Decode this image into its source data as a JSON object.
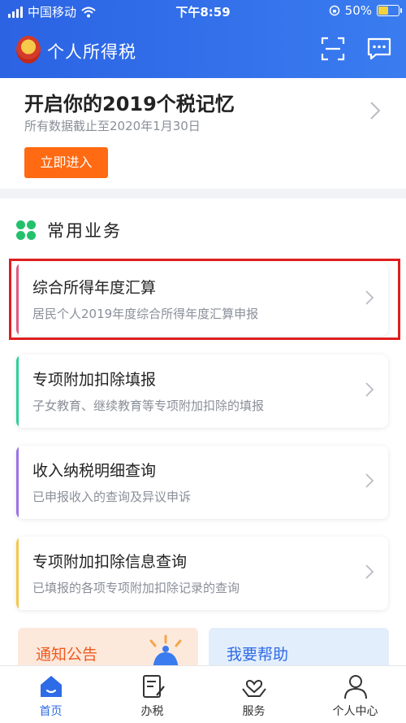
{
  "status": {
    "carrier": "中国移动",
    "time": "下午8:59",
    "battery": "50%"
  },
  "header": {
    "title": "个人所得税"
  },
  "banner": {
    "title": "开启你的2019个税记忆",
    "subtitle": "所有数据截止至2020年1月30日",
    "button": "立即进入"
  },
  "section": {
    "title": "常用业务"
  },
  "cards": [
    {
      "title": "综合所得年度汇算",
      "subtitle": "居民个人2019年度综合所得年度汇算申报",
      "accent": "#e05b7f"
    },
    {
      "title": "专项附加扣除填报",
      "subtitle": "子女教育、继续教育等专项附加扣除的填报",
      "accent": "#2fcf9a"
    },
    {
      "title": "收入纳税明细查询",
      "subtitle": "已申报收入的查询及异议申诉",
      "accent": "#9a72e8"
    },
    {
      "title": "专项附加扣除信息查询",
      "subtitle": "已填报的各项专项附加扣除记录的查询",
      "accent": "#f3c84a"
    }
  ],
  "tiles": {
    "notice": "通知公告",
    "help": "我要帮助"
  },
  "tabs": [
    {
      "label": "首页",
      "icon": "home-icon"
    },
    {
      "label": "办税",
      "icon": "tax-form-icon"
    },
    {
      "label": "服务",
      "icon": "heart-hands-icon"
    },
    {
      "label": "个人中心",
      "icon": "person-icon"
    }
  ],
  "colors": {
    "primary": "#2e6be6",
    "accent_orange": "#ff6a12",
    "highlight_red": "#e01e1e",
    "green": "#23c16b"
  }
}
